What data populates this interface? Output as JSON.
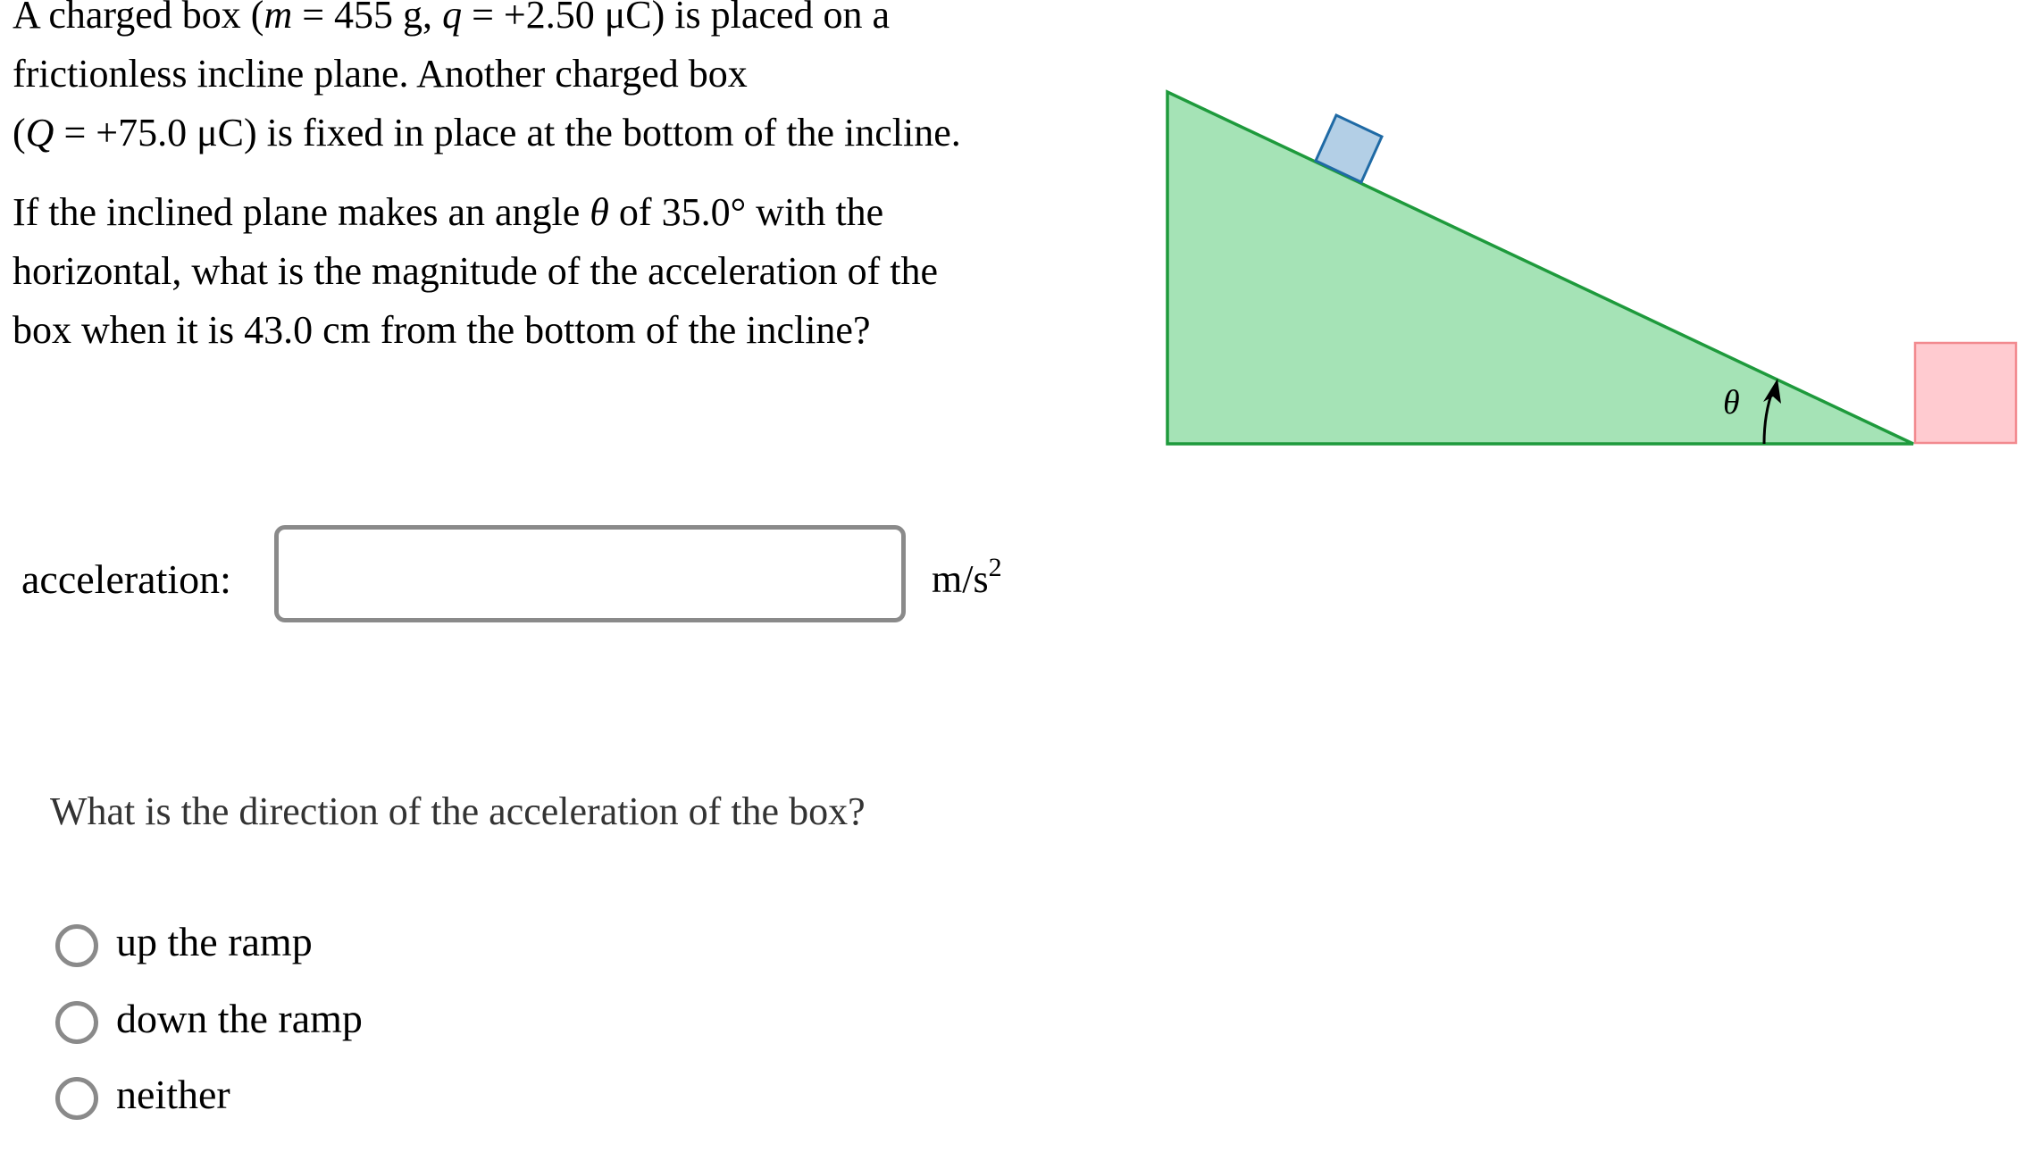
{
  "problem": {
    "paragraph1_lines": [
      [
        {
          "text": "A charged box (",
          "italic": false
        },
        {
          "text": "m",
          "italic": true
        },
        {
          "text": " = 455 g, ",
          "italic": false
        },
        {
          "text": "q",
          "italic": true
        },
        {
          "text": " = +2.50 μC) is placed on a",
          "italic": false
        }
      ],
      [
        {
          "text": "frictionless incline plane. Another charged box",
          "italic": false
        }
      ],
      [
        {
          "text": "(",
          "italic": false
        },
        {
          "text": "Q",
          "italic": true
        },
        {
          "text": " = +75.0 μC) is fixed in place at the bottom of the incline.",
          "italic": false
        }
      ]
    ],
    "paragraph2_lines": [
      [
        {
          "text": "If the inclined plane makes an angle ",
          "italic": false
        },
        {
          "text": "θ",
          "italic": true
        },
        {
          "text": " of 35.0° with the",
          "italic": false
        }
      ],
      [
        {
          "text": "horizontal, what is the magnitude of the acceleration of the",
          "italic": false
        }
      ],
      [
        {
          "text": "box when it is 43.0 cm from the bottom of the incline?",
          "italic": false
        }
      ]
    ],
    "given": {
      "mass": "455 g",
      "charge_q": "+2.50 μC",
      "charge_Q": "+75.0 μC",
      "angle": "35.0°",
      "distance": "43.0 cm"
    }
  },
  "answer": {
    "label": "acceleration:",
    "value": "",
    "placeholder": "",
    "unit_base": "m/s",
    "unit_exponent": "2"
  },
  "direction_question": {
    "prompt": "What is the direction of the acceleration of the box?",
    "options": [
      {
        "label": "up the ramp",
        "selected": false
      },
      {
        "label": "down the ramp",
        "selected": false
      },
      {
        "label": "neither",
        "selected": false
      }
    ]
  },
  "figure": {
    "angle_label": "θ",
    "colors": {
      "incline_fill": "#a5e3b6",
      "incline_stroke": "#1e9a3c",
      "moving_box_fill": "#b3cfe6",
      "moving_box_stroke": "#1f6aa5",
      "fixed_box_fill": "#ffcbd0",
      "fixed_box_stroke": "#f28a8f",
      "arrow": "#000000"
    }
  }
}
